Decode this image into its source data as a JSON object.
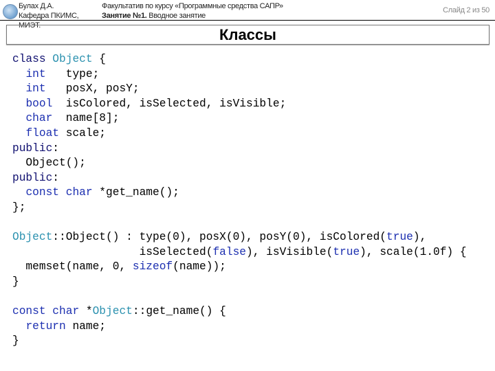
{
  "header": {
    "author_line1": "Булах Д.А.",
    "author_line2": "Кафедра ПКИМС,",
    "author_line3": "МИЭТ.",
    "course": "Факультатив по курсу «Программные средства САПР»",
    "lesson_bold": "Занятие №1.",
    "lesson_rest": " Вводное занятие",
    "slide_counter": "Слайд 2 из 50"
  },
  "title": "Классы",
  "colors": {
    "keyword": "#1c2fb0",
    "type_name": "#2b91af"
  },
  "code": {
    "lines": [
      [
        {
          "t": "class",
          "k": "kd"
        },
        {
          "t": " ",
          "k": "n"
        },
        {
          "t": "Object",
          "k": "t"
        },
        {
          "t": " {",
          "k": "n"
        }
      ],
      [
        {
          "t": "  ",
          "k": "n"
        },
        {
          "t": "int",
          "k": "k"
        },
        {
          "t": "   type;",
          "k": "n"
        }
      ],
      [
        {
          "t": "  ",
          "k": "n"
        },
        {
          "t": "int",
          "k": "k"
        },
        {
          "t": "   posX, posY;",
          "k": "n"
        }
      ],
      [
        {
          "t": "  ",
          "k": "n"
        },
        {
          "t": "bool",
          "k": "k"
        },
        {
          "t": "  isColored, isSelected, isVisible;",
          "k": "n"
        }
      ],
      [
        {
          "t": "  ",
          "k": "n"
        },
        {
          "t": "char",
          "k": "k"
        },
        {
          "t": "  name[8];",
          "k": "n"
        }
      ],
      [
        {
          "t": "  ",
          "k": "n"
        },
        {
          "t": "float",
          "k": "k"
        },
        {
          "t": " scale;",
          "k": "n"
        }
      ],
      [
        {
          "t": "public",
          "k": "kd"
        },
        {
          "t": ":",
          "k": "n"
        }
      ],
      [
        {
          "t": "  Object();",
          "k": "n"
        }
      ],
      [
        {
          "t": "public",
          "k": "kd"
        },
        {
          "t": ":",
          "k": "n"
        }
      ],
      [
        {
          "t": "  ",
          "k": "n"
        },
        {
          "t": "const",
          "k": "k"
        },
        {
          "t": " ",
          "k": "n"
        },
        {
          "t": "char",
          "k": "k"
        },
        {
          "t": " *get_name();",
          "k": "n"
        }
      ],
      [
        {
          "t": "};",
          "k": "n"
        }
      ],
      [],
      [
        {
          "t": "Object",
          "k": "t"
        },
        {
          "t": "::Object() : type(0), posX(0), posY(0), isColored(",
          "k": "n"
        },
        {
          "t": "true",
          "k": "k"
        },
        {
          "t": "),",
          "k": "n"
        }
      ],
      [
        {
          "t": "                   isSelected(",
          "k": "n"
        },
        {
          "t": "false",
          "k": "k"
        },
        {
          "t": "), isVisible(",
          "k": "n"
        },
        {
          "t": "true",
          "k": "k"
        },
        {
          "t": "), scale(1.0f) {",
          "k": "n"
        }
      ],
      [
        {
          "t": "  memset(name, 0, ",
          "k": "n"
        },
        {
          "t": "sizeof",
          "k": "k"
        },
        {
          "t": "(name));",
          "k": "n"
        }
      ],
      [
        {
          "t": "}",
          "k": "n"
        }
      ],
      [],
      [
        {
          "t": "const",
          "k": "k"
        },
        {
          "t": " ",
          "k": "n"
        },
        {
          "t": "char",
          "k": "k"
        },
        {
          "t": " *",
          "k": "n"
        },
        {
          "t": "Object",
          "k": "t"
        },
        {
          "t": "::get_name() {",
          "k": "n"
        }
      ],
      [
        {
          "t": "  ",
          "k": "n"
        },
        {
          "t": "return",
          "k": "k"
        },
        {
          "t": " name;",
          "k": "n"
        }
      ],
      [
        {
          "t": "}",
          "k": "n"
        }
      ]
    ]
  }
}
